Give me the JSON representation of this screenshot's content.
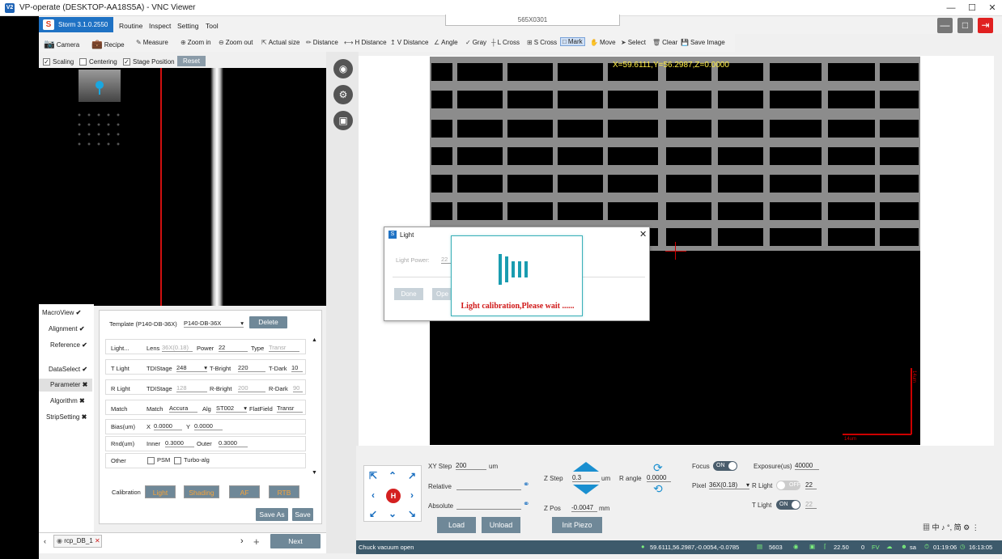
{
  "window": {
    "title": "VP-operate (DESKTOP-AA18S5A) - VNC Viewer",
    "remote_resolution": "565X0301"
  },
  "app": {
    "brand": "Storm 3.1.0.2550",
    "menus": [
      "Routine",
      "Inspect",
      "Setting",
      "Tool"
    ]
  },
  "toolbar": {
    "camera": "Camera",
    "recipe": "Recipe",
    "measure": "Measure",
    "zoom_in": "Zoom in",
    "zoom_out": "Zoom out",
    "actual_size": "Actual size",
    "distance": "Distance",
    "h_distance": "H Distance",
    "v_distance": "V Distance",
    "angle": "Angle",
    "gray": "Gray",
    "l_cross": "L Cross",
    "s_cross": "S Cross",
    "mark": "Mark",
    "move": "Move",
    "select": "Select",
    "clear": "Clear",
    "save_image": "Save Image"
  },
  "options": {
    "scaling": "Scaling",
    "centering": "Centering",
    "stage_position": "Stage Position",
    "reset": "Reset"
  },
  "side_tabs": {
    "macroview": "MacroView",
    "alignment": "Alignment",
    "reference": "Reference",
    "dataselect": "DataSelect",
    "parameter": "Parameter",
    "algorithm": "Algorithm",
    "stripsetting": "StripSetting"
  },
  "params": {
    "template_label": "Template (P140-DB-36X)",
    "template_value": "P140-DB-36X",
    "delete": "Delete",
    "light_label": "Light...",
    "lens_label": "Lens",
    "lens_value": "36X(0.18)",
    "power_label": "Power",
    "power_value": "22",
    "type_label": "Type",
    "type_value": "Transr",
    "tlight_label": "T Light",
    "tdistage_label": "TDIStage",
    "t_tdistage_value": "248",
    "tbright_label": "T-Bright",
    "tbright_value": "220",
    "tdark_label": "T-Dark",
    "tdark_value": "10",
    "rlight_label": "R Light",
    "r_tdistage_value": "128",
    "rbright_label": "R-Bright",
    "rbright_value": "200",
    "rdark_label": "R-Dark",
    "rdark_value": "90",
    "match_label": "Match",
    "match_inner_label": "Match",
    "match_value": "Accura",
    "alg_label": "Alg",
    "alg_value": "ST002",
    "flatfield_label": "FlatField",
    "flatfield_value": "Transr",
    "bias_label": "Bias(um)",
    "x_label": "X",
    "x_value": "0.0000",
    "y_label": "Y",
    "y_value": "0.0000",
    "rnd_label": "Rnd(um)",
    "inner_label": "Inner",
    "inner_value": "0.3000",
    "outer_label": "Outer",
    "outer_value": "0.3000",
    "other_label": "Other",
    "psm": "PSM",
    "turbo": "Turbo-alg",
    "calibration_label": "Calibration",
    "cal_light": "Light",
    "cal_shading": "Shading",
    "cal_af": "AF",
    "cal_rtb": "RTB",
    "save_as": "Save As",
    "save": "Save"
  },
  "bottom_left": {
    "recipe_tab": "rcp_DB_1",
    "next": "Next"
  },
  "camera": {
    "coord": "X=59.6111,Y=56.2987,Z=0.0000",
    "scale_v": "14um",
    "scale_h": "14um"
  },
  "light_dialog": {
    "title": "Light",
    "light_power_label": "Light Power:",
    "light_power_value": "22",
    "done": "Done",
    "open": "Ope",
    "busy_text": "Light calibration,Please wait ......"
  },
  "controls": {
    "xy_step_label": "XY Step",
    "xy_step_value": "200",
    "um": "um",
    "relative": "Relative",
    "absolute": "Absolute",
    "z_step_label": "Z Step",
    "z_step_value": "0.3",
    "z_pos_label": "Z Pos",
    "z_pos_value": "-0.0047",
    "mm": "mm",
    "r_angle_label": "R angle",
    "r_angle_value": "0.0000",
    "focus_label": "Focus",
    "focus_state": "ON",
    "exposure_label": "Exposure(us)",
    "exposure_value": "40000",
    "pixel_label": "Pixel",
    "pixel_value": "36X(0.18)",
    "r_light_label": "R Light",
    "r_light_state": "OFF",
    "r_light_value": "22",
    "t_light_label": "T Light",
    "t_light_state": "ON",
    "t_light_value": "22",
    "load": "Load",
    "unload": "Unload",
    "init_piezo": "Init Piezo",
    "home": "H"
  },
  "statusbar": {
    "message": "Chuck vacuum open",
    "position": "59.6111,56.2987,-0.0054,-0.0785",
    "count": "5603",
    "temp": "22.50",
    "fv_count": "0",
    "fv": "FV",
    "user": "sa",
    "elapsed": "01:19:06",
    "clock": "16:13:05"
  },
  "tray": {
    "text": "中 ♪ °, 简"
  }
}
